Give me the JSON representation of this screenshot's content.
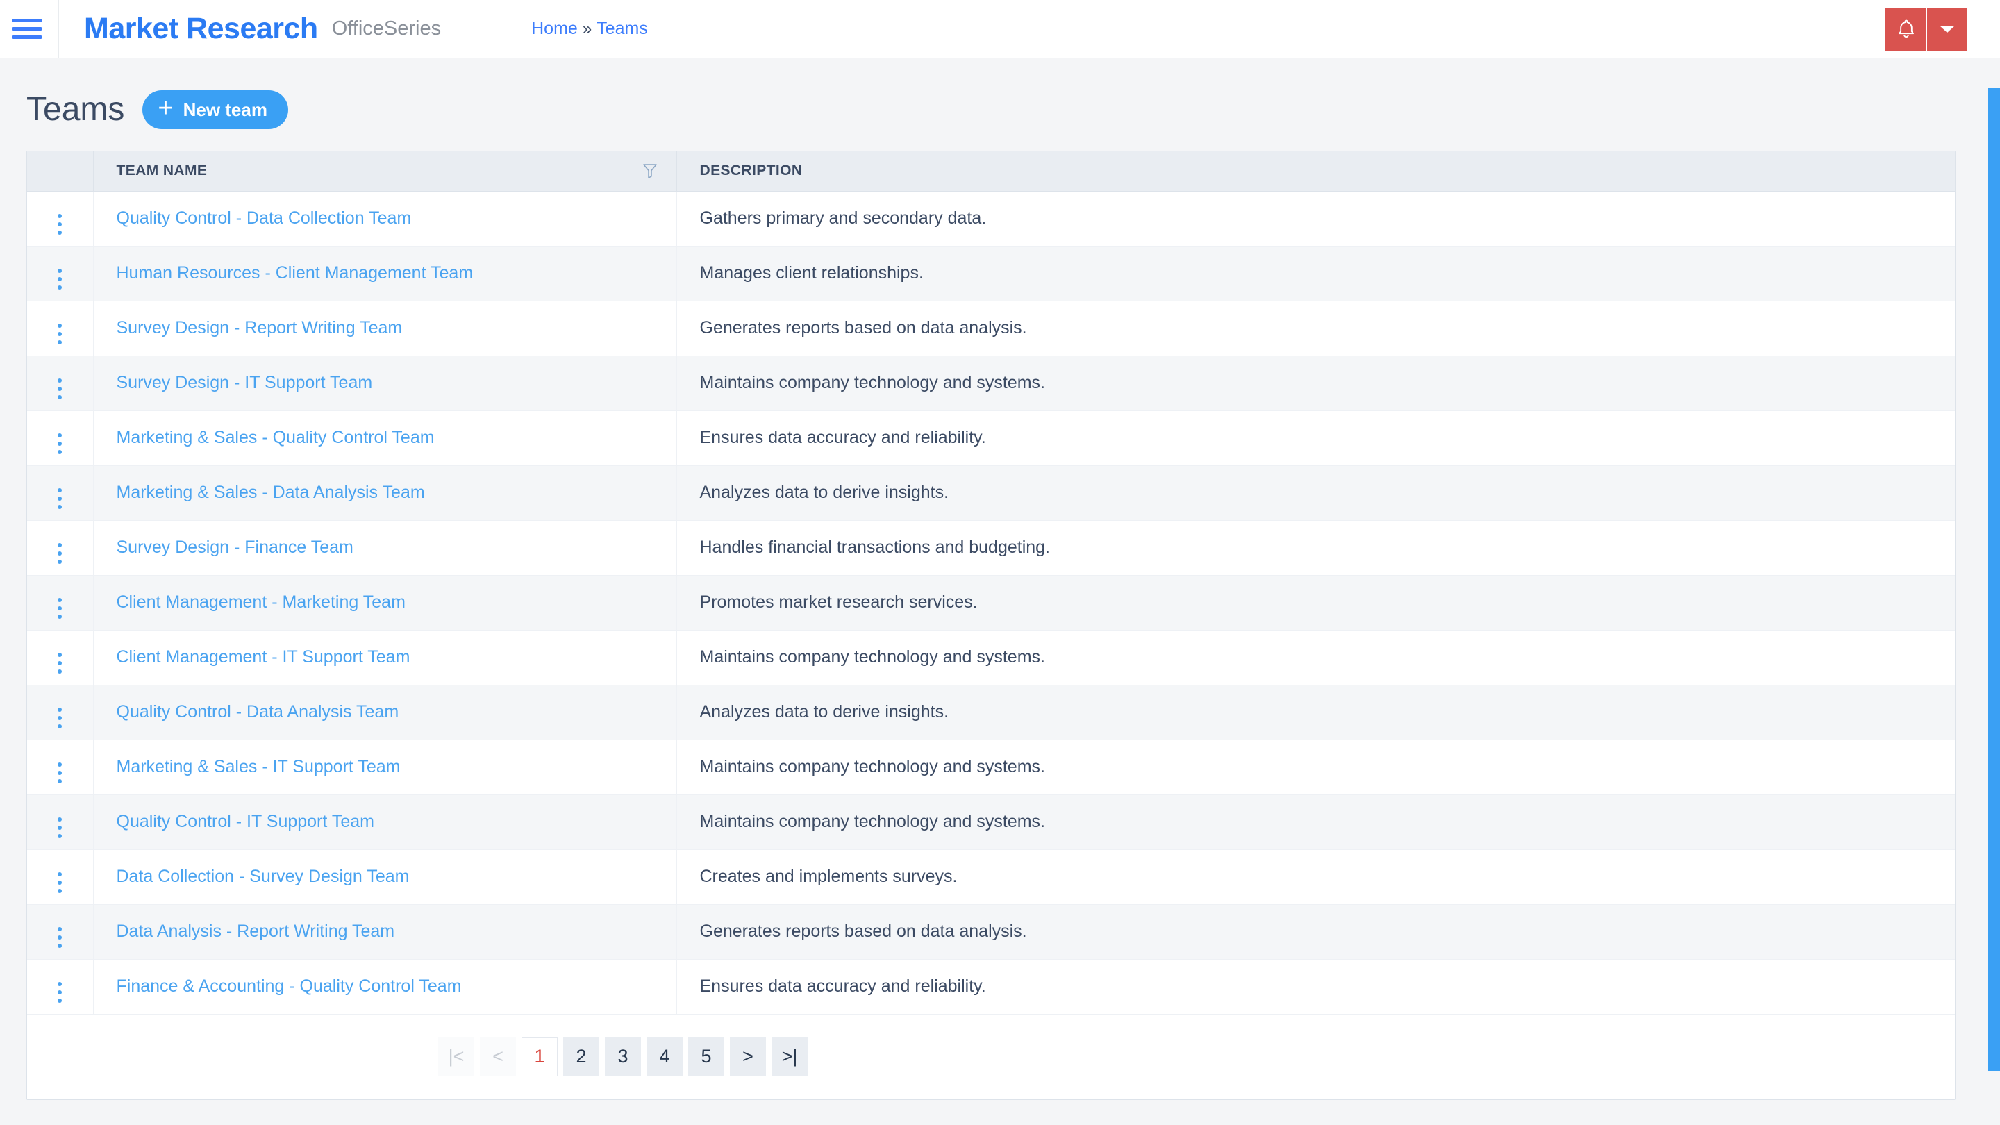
{
  "navbar": {
    "menu_icon": "hamburger-icon",
    "brand": "Market Research",
    "brand_sub": "OfficeSeries",
    "breadcrumb": {
      "home": "Home",
      "separator": "»",
      "current": "Teams"
    },
    "notification_icon": "bell-icon",
    "dropdown_icon": "caret-down-icon",
    "accent_red": "#d9534f",
    "accent_blue": "#2b7bf3"
  },
  "page": {
    "title": "Teams",
    "new_button": {
      "label": "New team",
      "icon": "plus-icon"
    }
  },
  "table": {
    "columns": [
      "TEAM NAME",
      "DESCRIPTION"
    ],
    "filter_icon": "filter-funnel-icon",
    "row_menu_icon": "vertical-dots-icon",
    "rows": [
      {
        "name": "Quality Control - Data Collection Team",
        "description": "Gathers primary and secondary data."
      },
      {
        "name": "Human Resources - Client Management Team",
        "description": "Manages client relationships."
      },
      {
        "name": "Survey Design - Report Writing Team",
        "description": "Generates reports based on data analysis."
      },
      {
        "name": "Survey Design - IT Support Team",
        "description": "Maintains company technology and systems."
      },
      {
        "name": "Marketing & Sales - Quality Control Team",
        "description": "Ensures data accuracy and reliability."
      },
      {
        "name": "Marketing & Sales - Data Analysis Team",
        "description": "Analyzes data to derive insights."
      },
      {
        "name": "Survey Design - Finance Team",
        "description": "Handles financial transactions and budgeting."
      },
      {
        "name": "Client Management - Marketing Team",
        "description": "Promotes market research services."
      },
      {
        "name": "Client Management - IT Support Team",
        "description": "Maintains company technology and systems."
      },
      {
        "name": "Quality Control - Data Analysis Team",
        "description": "Analyzes data to derive insights."
      },
      {
        "name": "Marketing & Sales - IT Support Team",
        "description": "Maintains company technology and systems."
      },
      {
        "name": "Quality Control - IT Support Team",
        "description": "Maintains company technology and systems."
      },
      {
        "name": "Data Collection - Survey Design Team",
        "description": "Creates and implements surveys."
      },
      {
        "name": "Data Analysis - Report Writing Team",
        "description": "Generates reports based on data analysis."
      },
      {
        "name": "Finance & Accounting - Quality Control Team",
        "description": "Ensures data accuracy and reliability."
      }
    ]
  },
  "pagination": {
    "first_label": "|<",
    "prev_label": "<",
    "pages": [
      "1",
      "2",
      "3",
      "4",
      "5"
    ],
    "active_page": "1",
    "next_label": ">",
    "last_label": ">|",
    "active_color": "#d9463d"
  }
}
